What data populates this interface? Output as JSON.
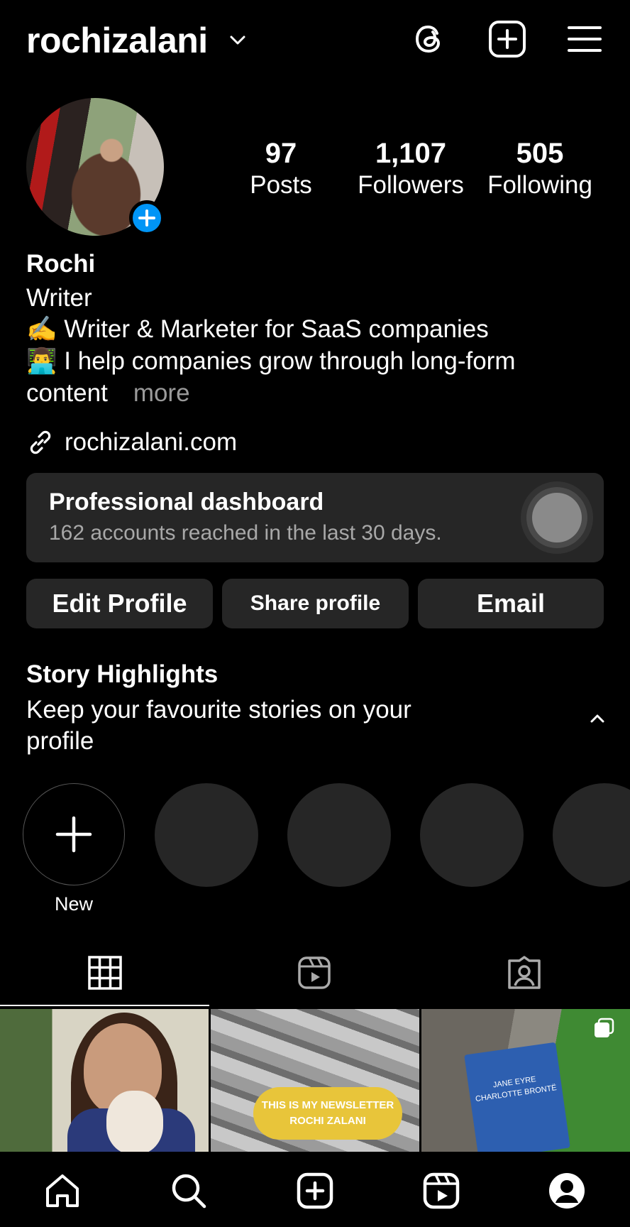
{
  "header": {
    "username": "rochizalani",
    "icons": [
      "chevron-down-icon",
      "threads-icon",
      "create-post-icon",
      "menu-icon"
    ]
  },
  "stats": [
    {
      "value": "97",
      "label": "Posts"
    },
    {
      "value": "1,107",
      "label": "Followers"
    },
    {
      "value": "505",
      "label": "Following"
    }
  ],
  "bio": {
    "name": "Rochi",
    "category": "Writer",
    "line1": "✍️ Writer & Marketer for SaaS companies",
    "line2": "👨‍💻 I help companies grow through long-form",
    "line3": "content",
    "more": "more",
    "link": "rochizalani.com"
  },
  "dashboard": {
    "title": "Professional dashboard",
    "subtitle": "162 accounts reached in the last 30 days."
  },
  "buttons": {
    "edit": "Edit Profile",
    "share": "Share profile",
    "email": "Email"
  },
  "highlights": {
    "title": "Story Highlights",
    "subtitle": "Keep your favourite stories on your profile",
    "new_label": "New"
  },
  "posts": {
    "newsletter_line1": "THIS IS MY NEWSLETTER",
    "newsletter_line2": "ROCHI ZALANI",
    "book_title": "JANE EYRE",
    "book_author": "CHARLOTTE BRONTË"
  },
  "colors": {
    "accent": "#0095f6",
    "surface": "#262626",
    "muted": "#a8a8a8"
  }
}
